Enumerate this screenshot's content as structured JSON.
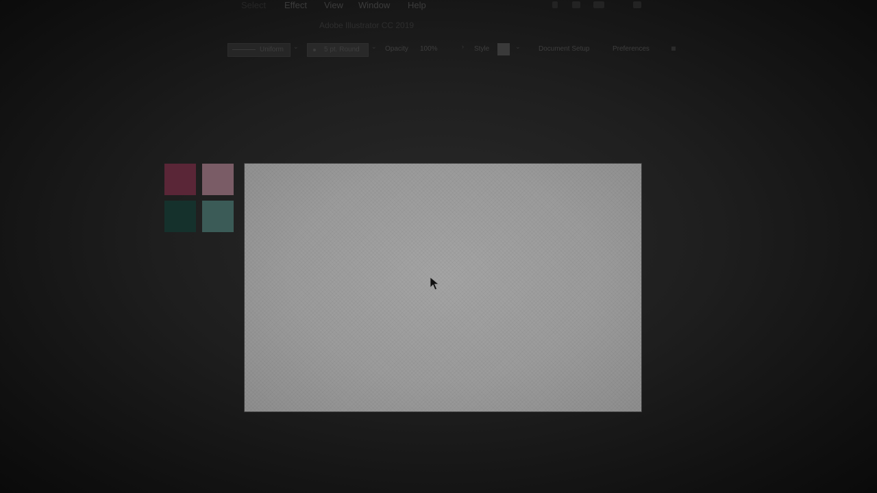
{
  "menubar": {
    "items": [
      {
        "label": "Select"
      },
      {
        "label": "Effect"
      },
      {
        "label": "View"
      },
      {
        "label": "Window"
      },
      {
        "label": "Help"
      }
    ]
  },
  "app": {
    "title": "Adobe Illustrator CC 2019"
  },
  "controlbar": {
    "stroke_profile": "Uniform",
    "brush": "5 pt. Round",
    "opacity_label": "Opacity",
    "opacity_value": "100%",
    "style_label": "Style",
    "document_setup_label": "Document Setup",
    "preferences_label": "Preferences"
  },
  "swatches": [
    {
      "color": "#5a2637"
    },
    {
      "color": "#7a5c66"
    },
    {
      "color": "#15312c"
    },
    {
      "color": "#3b5b57"
    }
  ],
  "icons": {
    "stroke_dropdown": "chevron-down-icon",
    "brush_dropdown": "chevron-down-icon",
    "opacity_expand": "chevron-right-icon",
    "style_dropdown": "chevron-down-icon",
    "cursor": "arrow-cursor-icon"
  }
}
